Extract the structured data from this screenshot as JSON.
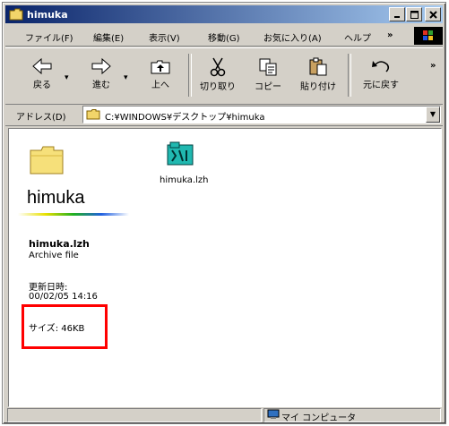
{
  "window": {
    "title": "himuka"
  },
  "menu": {
    "items": [
      "ファイル(F)",
      "編集(E)",
      "表示(V)",
      "移動(G)",
      "お気に入り(A)",
      "ヘルプ"
    ],
    "overflow": "»"
  },
  "toolbar": {
    "buttons": [
      {
        "label": "戻る",
        "icon": "back-arrow-icon"
      },
      {
        "label": "進む",
        "icon": "forward-arrow-icon"
      },
      {
        "label": "上へ",
        "icon": "up-folder-icon"
      },
      {
        "label": "切り取り",
        "icon": "scissors-icon"
      },
      {
        "label": "コピー",
        "icon": "copy-icon"
      },
      {
        "label": "貼り付け",
        "icon": "paste-icon"
      },
      {
        "label": "元に戻す",
        "icon": "undo-icon"
      }
    ],
    "overflow": "»"
  },
  "address": {
    "label": "アドレス(D)",
    "value": "C:¥WINDOWS¥デスクトップ¥himuka"
  },
  "sidebar": {
    "folder_title": "himuka",
    "file_name": "himuka.lzh",
    "file_type": "Archive file",
    "date_label": "更新日時:",
    "date_value": "00/02/05 14:16",
    "size_text": "サイズ: 46KB"
  },
  "files": [
    {
      "name": "himuka.lzh",
      "icon": "lzh-archive-icon"
    }
  ],
  "status": {
    "zone": "マイ コンピュータ"
  },
  "colors": {
    "highlight": "#ff0000",
    "titlebar": "#0a246a"
  }
}
